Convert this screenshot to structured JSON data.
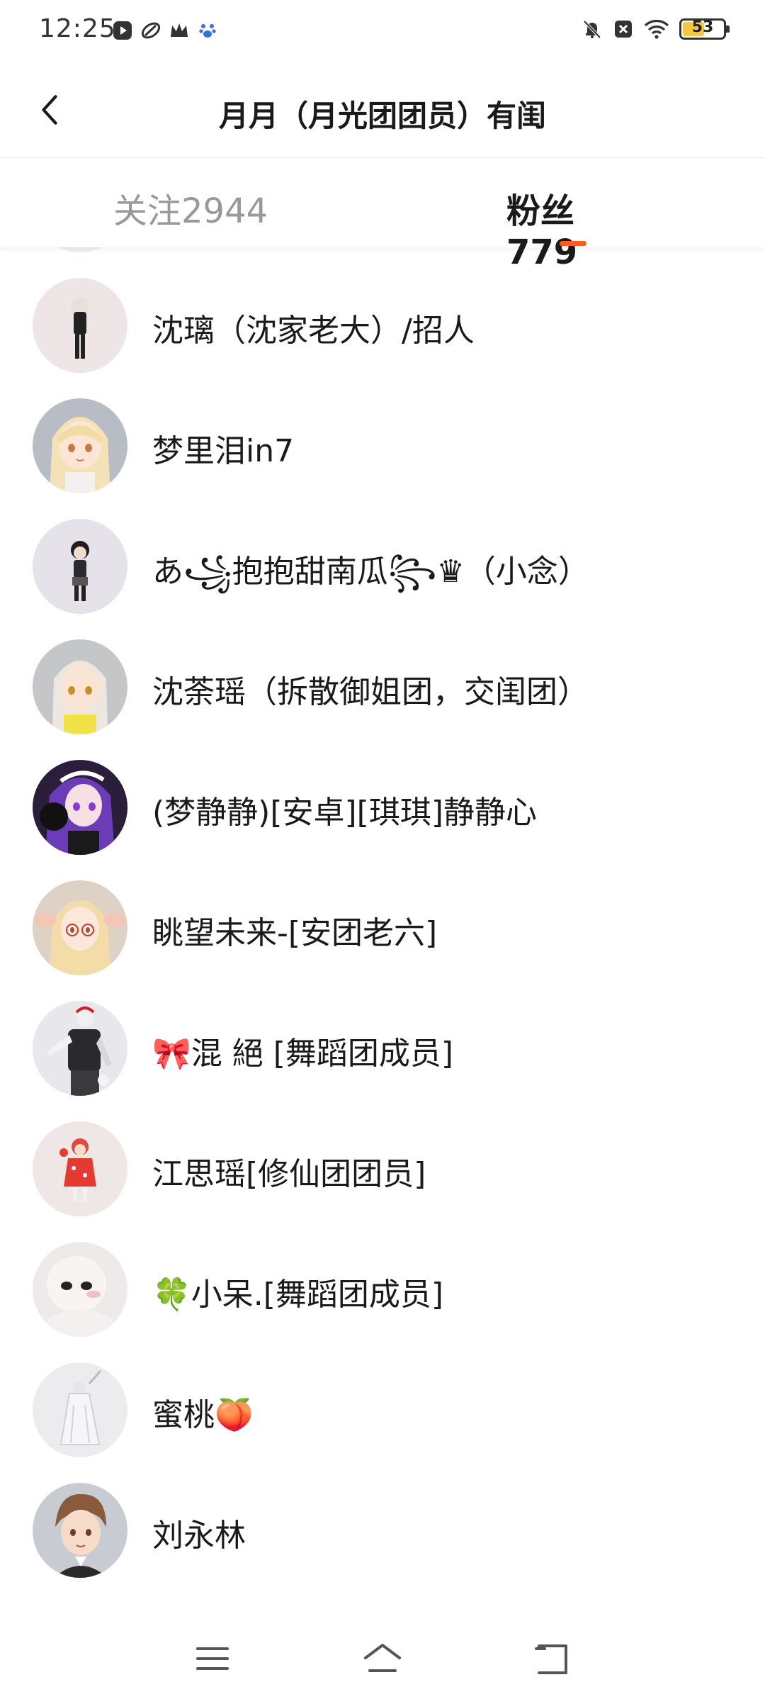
{
  "status_bar": {
    "time": "12:25",
    "battery_level": 53,
    "battery_label": "53",
    "battery_color": "#f3c845",
    "left_icons": [
      "play-badge-icon",
      "leaf-app-icon",
      "crown-icon",
      "paw-icon"
    ],
    "right_icons": [
      "bell-muted-icon",
      "close-badge-icon",
      "wifi-icon",
      "battery-icon"
    ]
  },
  "header": {
    "title": "月月（月光团团员）有闺",
    "back_icon": "chevron-left-icon"
  },
  "tabs": [
    {
      "label": "关注2944",
      "active": false
    },
    {
      "label": "粉丝779",
      "active": true
    }
  ],
  "accent_color": "#ff5a1f",
  "followers": [
    {
      "name": "",
      "avatar": "avatar-partial"
    },
    {
      "name": "沈璃（沈家老大）/招人",
      "avatar": "avatar-dark-dress"
    },
    {
      "name": "梦里泪in7",
      "avatar": "avatar-blonde"
    },
    {
      "name": "あ꧁抱抱甜南瓜꧂♛（小念）",
      "avatar": "avatar-black-hair"
    },
    {
      "name": "沈荼瑶（拆散御姐团，交闺团）",
      "avatar": "avatar-silver-hair"
    },
    {
      "name": "(梦静静)[安卓][琪琪]静静心",
      "avatar": "avatar-purple-hair"
    },
    {
      "name": "眺望未来-[安团老六]",
      "avatar": "avatar-glasses"
    },
    {
      "name": "🎀混 絕 [舞蹈团成员]",
      "avatar": "avatar-dancer"
    },
    {
      "name": "江思瑶[修仙团团员]",
      "avatar": "avatar-red-dress"
    },
    {
      "name": "🍀小呆.[舞蹈团成员]",
      "avatar": "avatar-pale"
    },
    {
      "name": "蜜桃🍑",
      "avatar": "avatar-white-dress"
    },
    {
      "name": "刘永林",
      "avatar": "avatar-brown-hair"
    }
  ],
  "nav_bar": {
    "icons": [
      "menu-icon",
      "home-icon",
      "back-icon"
    ]
  }
}
